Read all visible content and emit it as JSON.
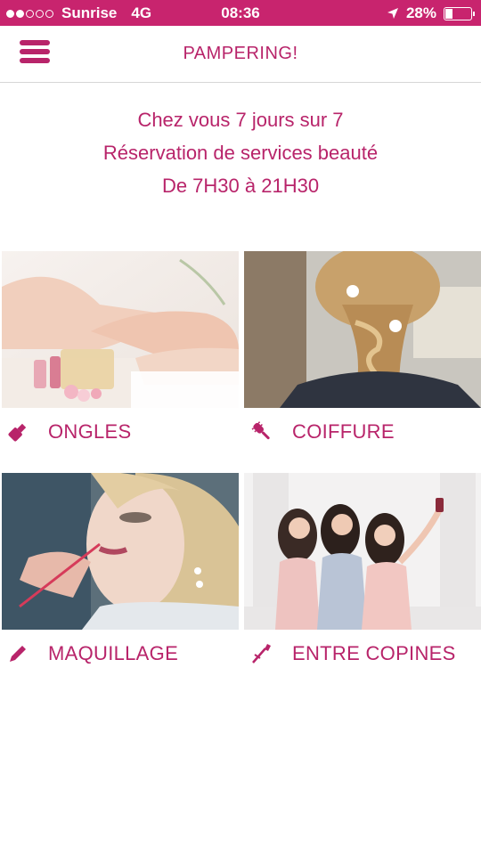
{
  "status_bar": {
    "carrier": "Sunrise",
    "network": "4G",
    "time": "08:36",
    "battery": "28%",
    "battery_level": 0.28,
    "signal_bars": 2,
    "color": "#c8246e"
  },
  "nav": {
    "title": "PAMPERING!",
    "menu_icon": "hamburger-menu-icon"
  },
  "intro": {
    "line1": "Chez vous 7 jours sur 7",
    "line2": "Réservation de services beauté",
    "line3": "De 7H30 à 21H30"
  },
  "categories": [
    {
      "label": "ONGLES",
      "icon": "nail-polish-icon"
    },
    {
      "label": "COIFFURE",
      "icon": "hair-brush-icon"
    },
    {
      "label": "MAQUILLAGE",
      "icon": "pencil-icon"
    },
    {
      "label": "ENTRE COPINES",
      "icon": "makeup-brush-icon"
    }
  ],
  "colors": {
    "accent": "#b8246a",
    "status_bar": "#c8246e"
  }
}
